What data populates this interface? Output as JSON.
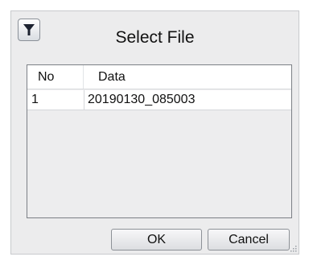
{
  "dialog": {
    "title": "Select File",
    "icon": "filter-icon"
  },
  "list": {
    "columns": [
      "No",
      "Data"
    ],
    "rows": [
      {
        "no": "1",
        "data": "20190130_085003"
      }
    ]
  },
  "buttons": {
    "ok": "OK",
    "cancel": "Cancel"
  },
  "colors": {
    "dialog_bg": "#ececed",
    "list_bg": "#ededee"
  }
}
